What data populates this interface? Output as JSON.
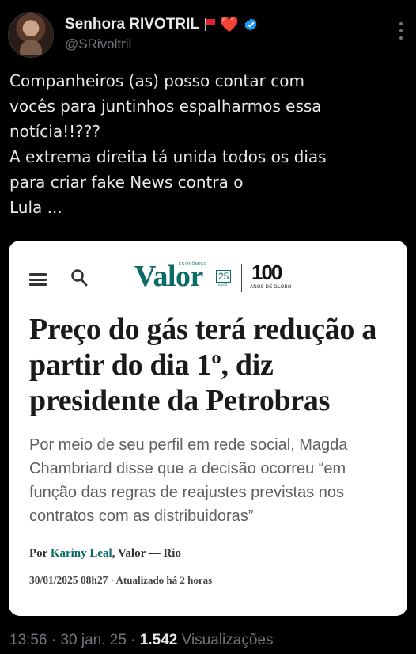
{
  "author": {
    "display_name": "Senhora RIVOTRIL",
    "emoji_heart": "❤️",
    "handle": "@SRivoltril",
    "verified_color": "#1d9bf0"
  },
  "tweet": {
    "text": "Companheiros (as) posso contar com\nvocês para juntinhos espalharmos essa\nnotícia!!???\nA extrema direita tá unida todos os dias\npara criar fake News contra o\nLula ..."
  },
  "card": {
    "brand_small": "ECONÔMICO",
    "brand": "Valor",
    "badge": "25",
    "badge_sub": "ANOS",
    "logo100": "100",
    "logo100_sub": "ANOS DE GLOBO",
    "headline": "Preço do gás terá redução a partir do dia 1º, diz presidente da Petrobras",
    "subtitle": "Por meio de seu perfil em rede social, Magda Chambriard disse que a decisão ocorreu “em função das regras de reajustes previstas nos contratos com as distribuidoras”",
    "byline_prefix": "Por ",
    "byline_author": "Kariny Leal",
    "byline_suffix": ", Valor — Rio",
    "date": "30/01/2025 08h27",
    "updated": " · Atualizado há 2 horas",
    "brand_color": "#0c6b68"
  },
  "footer": {
    "time": "13:56",
    "sep1": " · ",
    "date": "30 jan. 25",
    "sep2": " · ",
    "views_count": "1.542",
    "views_label": " Visualizações"
  }
}
